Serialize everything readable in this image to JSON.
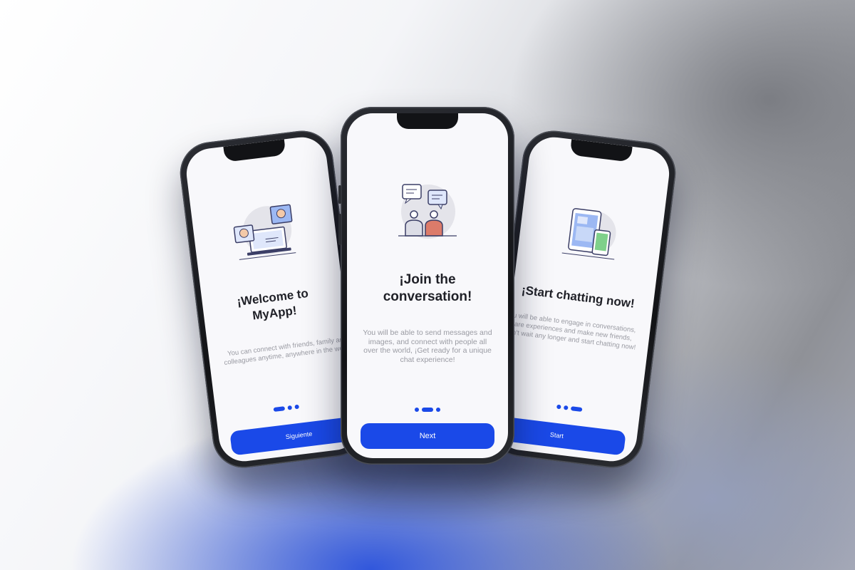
{
  "colors": {
    "accent": "#1a49e8",
    "title": "#1f2027",
    "body_text": "#9a9ba3",
    "screen_bg": "#f8f8fb"
  },
  "screens": [
    {
      "title": "¡Welcome to MyApp!",
      "description": "You can connect with friends, family and colleagues anytime, anywhere in the world.",
      "button_label": "Siguiente",
      "illustration": "video-call-icon",
      "active_page": 1,
      "page_count": 3
    },
    {
      "title": "¡Join the conversation!",
      "description": "You will be able to send messages and images, and connect with people all over the world, ¡Get ready for a unique chat experience!",
      "button_label": "Next",
      "illustration": "chat-people-icon",
      "active_page": 2,
      "page_count": 3
    },
    {
      "title": "¡Start chatting now!",
      "description": "You will be able to engage in conversations, share experiences and make new friends, ¡Don't wait any longer and start chatting now!",
      "button_label": "Start",
      "illustration": "devices-icon",
      "active_page": 3,
      "page_count": 3
    }
  ]
}
